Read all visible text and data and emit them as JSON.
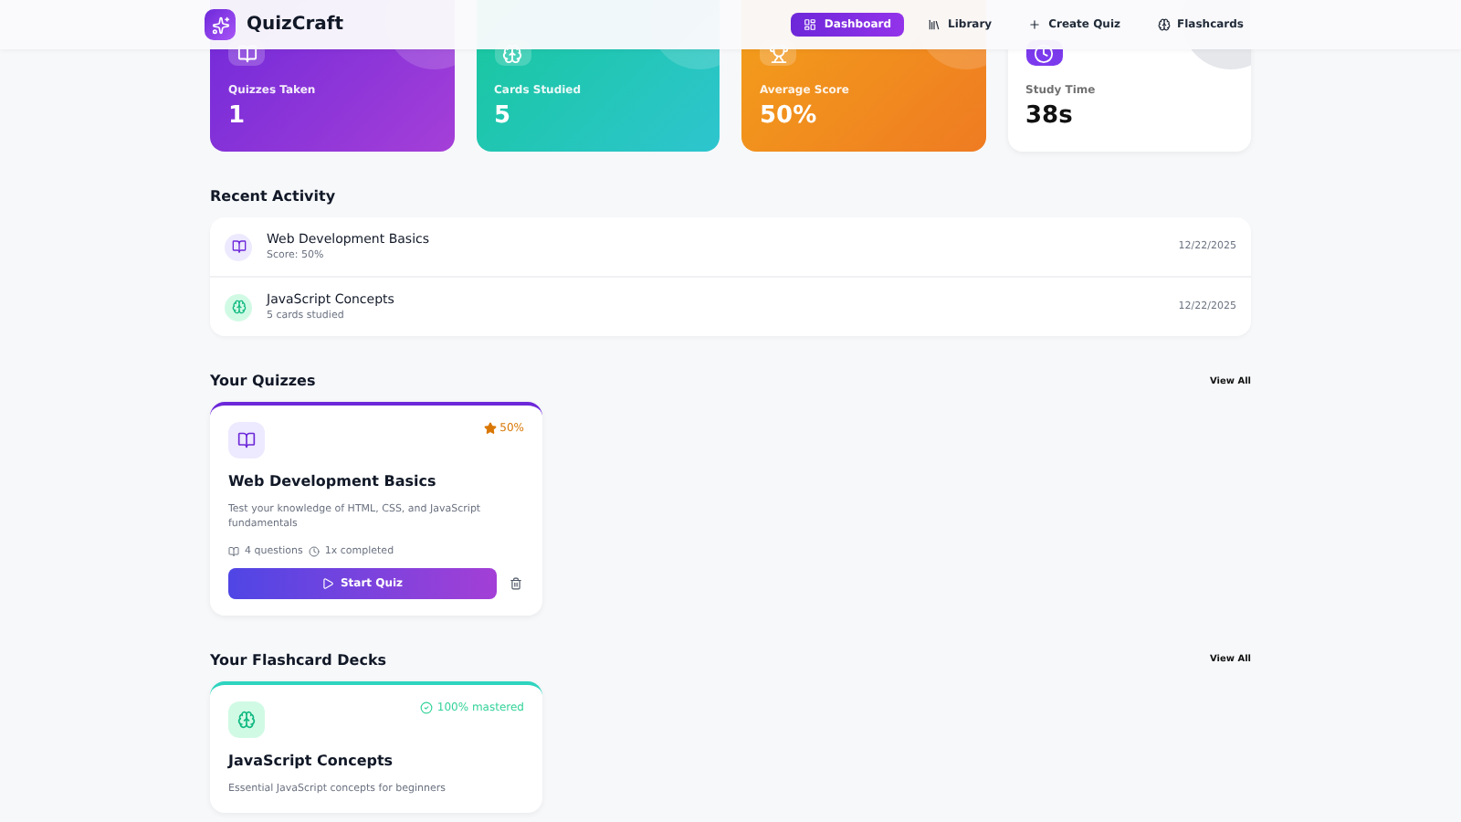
{
  "brand": {
    "name": "QuizCraft"
  },
  "nav": [
    {
      "label": "Dashboard",
      "selected": true
    },
    {
      "label": "Library",
      "selected": false
    },
    {
      "label": "Create Quiz",
      "selected": false
    },
    {
      "label": "Flashcards",
      "selected": false
    }
  ],
  "stats": [
    {
      "label": "Quizzes Taken",
      "value": "1",
      "kind": "filled"
    },
    {
      "label": "Cards Studied",
      "value": "5",
      "kind": "filled"
    },
    {
      "label": "Average Score",
      "value": "50%",
      "kind": "filled"
    },
    {
      "label": "Study Time",
      "value": "38s",
      "kind": "plain"
    }
  ],
  "recent_activity": {
    "title": "Recent Activity",
    "items": [
      {
        "kind": "quiz",
        "title": "Web Development Basics",
        "detail": "Score: 50%",
        "date": "12/22/2025"
      },
      {
        "kind": "flashcard",
        "title": "JavaScript Concepts",
        "detail": "5 cards studied",
        "date": "12/22/2025"
      }
    ]
  },
  "quizzes": {
    "title": "Your Quizzes",
    "view_all": "View All",
    "items": [
      {
        "title": "Web Development Basics",
        "score": "50%",
        "description": "Test your knowledge of HTML, CSS, and JavaScript fundamentals",
        "questions": "4 questions",
        "completed": "1x completed",
        "button": "Start Quiz"
      }
    ]
  },
  "decks": {
    "title": "Your Flashcard Decks",
    "view_all": "View All",
    "items": [
      {
        "title": "JavaScript Concepts",
        "mastered": "100% mastered",
        "description": "Essential JavaScript concepts for beginners"
      }
    ]
  }
}
